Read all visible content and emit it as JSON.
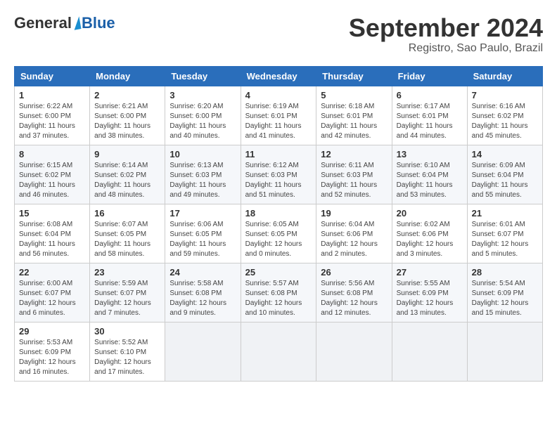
{
  "header": {
    "logo_general": "General",
    "logo_blue": "Blue",
    "month_title": "September 2024",
    "location": "Registro, Sao Paulo, Brazil"
  },
  "weekdays": [
    "Sunday",
    "Monday",
    "Tuesday",
    "Wednesday",
    "Thursday",
    "Friday",
    "Saturday"
  ],
  "weeks": [
    [
      {
        "day": "1",
        "sunrise": "6:22 AM",
        "sunset": "6:00 PM",
        "daylight": "11 hours and 37 minutes."
      },
      {
        "day": "2",
        "sunrise": "6:21 AM",
        "sunset": "6:00 PM",
        "daylight": "11 hours and 38 minutes."
      },
      {
        "day": "3",
        "sunrise": "6:20 AM",
        "sunset": "6:00 PM",
        "daylight": "11 hours and 40 minutes."
      },
      {
        "day": "4",
        "sunrise": "6:19 AM",
        "sunset": "6:01 PM",
        "daylight": "11 hours and 41 minutes."
      },
      {
        "day": "5",
        "sunrise": "6:18 AM",
        "sunset": "6:01 PM",
        "daylight": "11 hours and 42 minutes."
      },
      {
        "day": "6",
        "sunrise": "6:17 AM",
        "sunset": "6:01 PM",
        "daylight": "11 hours and 44 minutes."
      },
      {
        "day": "7",
        "sunrise": "6:16 AM",
        "sunset": "6:02 PM",
        "daylight": "11 hours and 45 minutes."
      }
    ],
    [
      {
        "day": "8",
        "sunrise": "6:15 AM",
        "sunset": "6:02 PM",
        "daylight": "11 hours and 46 minutes."
      },
      {
        "day": "9",
        "sunrise": "6:14 AM",
        "sunset": "6:02 PM",
        "daylight": "11 hours and 48 minutes."
      },
      {
        "day": "10",
        "sunrise": "6:13 AM",
        "sunset": "6:03 PM",
        "daylight": "11 hours and 49 minutes."
      },
      {
        "day": "11",
        "sunrise": "6:12 AM",
        "sunset": "6:03 PM",
        "daylight": "11 hours and 51 minutes."
      },
      {
        "day": "12",
        "sunrise": "6:11 AM",
        "sunset": "6:03 PM",
        "daylight": "11 hours and 52 minutes."
      },
      {
        "day": "13",
        "sunrise": "6:10 AM",
        "sunset": "6:04 PM",
        "daylight": "11 hours and 53 minutes."
      },
      {
        "day": "14",
        "sunrise": "6:09 AM",
        "sunset": "6:04 PM",
        "daylight": "11 hours and 55 minutes."
      }
    ],
    [
      {
        "day": "15",
        "sunrise": "6:08 AM",
        "sunset": "6:04 PM",
        "daylight": "11 hours and 56 minutes."
      },
      {
        "day": "16",
        "sunrise": "6:07 AM",
        "sunset": "6:05 PM",
        "daylight": "11 hours and 58 minutes."
      },
      {
        "day": "17",
        "sunrise": "6:06 AM",
        "sunset": "6:05 PM",
        "daylight": "11 hours and 59 minutes."
      },
      {
        "day": "18",
        "sunrise": "6:05 AM",
        "sunset": "6:05 PM",
        "daylight": "12 hours and 0 minutes."
      },
      {
        "day": "19",
        "sunrise": "6:04 AM",
        "sunset": "6:06 PM",
        "daylight": "12 hours and 2 minutes."
      },
      {
        "day": "20",
        "sunrise": "6:02 AM",
        "sunset": "6:06 PM",
        "daylight": "12 hours and 3 minutes."
      },
      {
        "day": "21",
        "sunrise": "6:01 AM",
        "sunset": "6:07 PM",
        "daylight": "12 hours and 5 minutes."
      }
    ],
    [
      {
        "day": "22",
        "sunrise": "6:00 AM",
        "sunset": "6:07 PM",
        "daylight": "12 hours and 6 minutes."
      },
      {
        "day": "23",
        "sunrise": "5:59 AM",
        "sunset": "6:07 PM",
        "daylight": "12 hours and 7 minutes."
      },
      {
        "day": "24",
        "sunrise": "5:58 AM",
        "sunset": "6:08 PM",
        "daylight": "12 hours and 9 minutes."
      },
      {
        "day": "25",
        "sunrise": "5:57 AM",
        "sunset": "6:08 PM",
        "daylight": "12 hours and 10 minutes."
      },
      {
        "day": "26",
        "sunrise": "5:56 AM",
        "sunset": "6:08 PM",
        "daylight": "12 hours and 12 minutes."
      },
      {
        "day": "27",
        "sunrise": "5:55 AM",
        "sunset": "6:09 PM",
        "daylight": "12 hours and 13 minutes."
      },
      {
        "day": "28",
        "sunrise": "5:54 AM",
        "sunset": "6:09 PM",
        "daylight": "12 hours and 15 minutes."
      }
    ],
    [
      {
        "day": "29",
        "sunrise": "5:53 AM",
        "sunset": "6:09 PM",
        "daylight": "12 hours and 16 minutes."
      },
      {
        "day": "30",
        "sunrise": "5:52 AM",
        "sunset": "6:10 PM",
        "daylight": "12 hours and 17 minutes."
      },
      null,
      null,
      null,
      null,
      null
    ]
  ]
}
